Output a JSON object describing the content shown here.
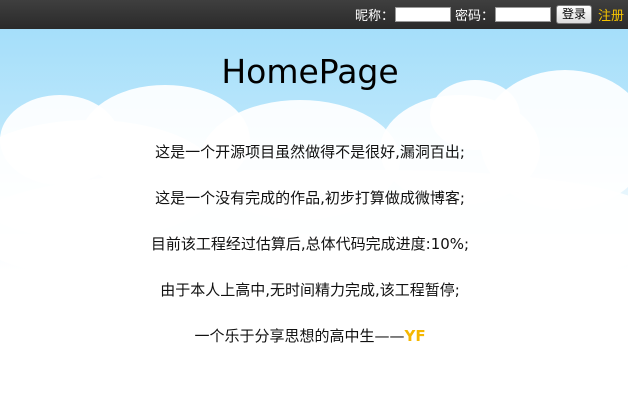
{
  "header": {
    "nickname_label": "昵称：",
    "password_label": "密码：",
    "login_button": "登录",
    "register_link": "注册"
  },
  "main": {
    "title": "HomePage",
    "lines": [
      "这是一个开源项目虽然做得不是很好,漏洞百出;",
      "这是一个没有完成的作品,初步打算做成微博客;",
      "目前该工程经过估算后,总体代码完成进度:10%;",
      "由于本人上高中,无时间精力完成,该工程暂停;"
    ],
    "signature": {
      "text": "一个乐于分享思想的高中生——",
      "name": "YF"
    }
  },
  "colors": {
    "topbar": "#333333",
    "accent": "#f5c300",
    "sky": "#9fdcfa"
  }
}
